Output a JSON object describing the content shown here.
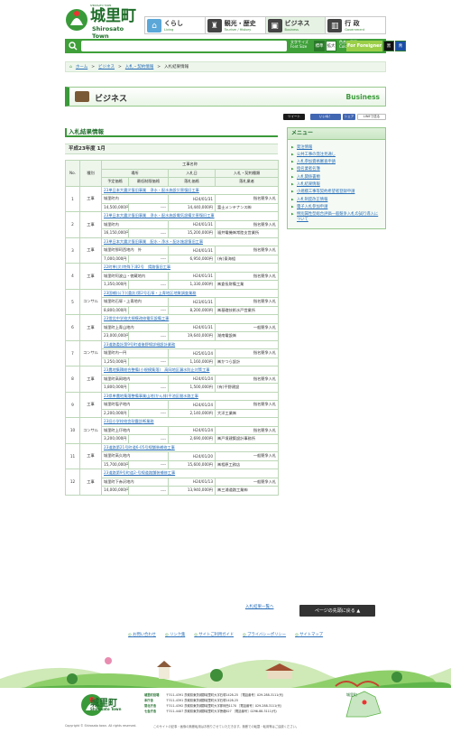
{
  "header": {
    "logo_tagline": "SHIROSATO TOWN",
    "logo_name": "城里町",
    "logo_en": "Shirosato Town",
    "nav": [
      {
        "label": "くらし",
        "en": "Living",
        "icon": "house-icon",
        "color": "#5aa7d8"
      },
      {
        "label": "観光・歴史",
        "en": "Tourism / History",
        "icon": "castle-icon",
        "color": "#444444"
      },
      {
        "label": "ビジネス",
        "en": "Business",
        "icon": "briefcase-icon",
        "color": "#444444"
      },
      {
        "label": "行 政",
        "en": "Government",
        "icon": "building-icon",
        "color": "#444444"
      }
    ],
    "search_placeholder": "",
    "font_size_label": "文字サイズ",
    "font_size_sub": "Font Size",
    "std_label": "標準",
    "large_label": "拡大",
    "color_label": "色合い変更",
    "color_sub": "Color Changer",
    "color_options": [
      "白",
      "黒",
      "青"
    ],
    "english_label": "For Foreigner"
  },
  "breadcrumb": [
    "ホーム",
    "ビジネス",
    "入札・契約情報",
    "入札結果情報"
  ],
  "page_heading": {
    "title": "ビジネス",
    "en": "Business"
  },
  "social": {
    "tweet": "ツイート",
    "like": "いいね！",
    "share": "シェア",
    "line": "LINEで送る"
  },
  "main": {
    "title": "入札結果情報",
    "period": "平成23年度 1月",
    "table_headers": {
      "no": "No.",
      "kind": "種別",
      "project": "工事名称",
      "location": "場所",
      "bid_date": "入札日",
      "method": "入札・契約種類",
      "planned_price": "予定価格",
      "min_price": "最低制限価格",
      "award_price": "落札価格",
      "awardee": "落札業者"
    },
    "rows": [
      {
        "no": "1",
        "kind": "工事",
        "name": "23単日本大震災復旧事業　浄水・配水施設災害復旧工事",
        "place": "城里町内",
        "date": "H24/01/31",
        "method": "指名競争入札",
        "planned": "14,500,000円",
        "min": "----",
        "award": "14,440,000円",
        "awardee": "富士メンテナンス㈱"
      },
      {
        "no": "2",
        "kind": "工事",
        "name": "23単日本大震災復旧事業　浄水・配水施設電気設備災害復旧工事",
        "place": "城里町内",
        "date": "H24/01/31",
        "method": "指名競争入札",
        "planned": "16,150,000円",
        "min": "----",
        "award": "15,200,000円",
        "awardee": "福井電機㈱常陸支営業所"
      },
      {
        "no": "3",
        "kind": "工事",
        "name": "23単日本大震災復旧事業　配水・浄水・配水施設復旧工事",
        "place": "城里町那珂西地内　外",
        "date": "H24/01/31",
        "method": "指名競争入札",
        "planned": "7,000,000円",
        "min": "----",
        "award": "6,950,000円",
        "awardee": "(有)東海組"
      },
      {
        "no": "4",
        "kind": "工事",
        "name": "22町単(災)特殊下津2号　錆路復旧工事",
        "place": "城里町阿波山・徳蔵地内",
        "date": "H24/01/31",
        "method": "指名競争入札",
        "planned": "1,350,000円",
        "min": "----",
        "award": "1,330,000円",
        "awardee": "㈱倉長財備工業"
      },
      {
        "no": "5",
        "kind": "コンサル",
        "name": "23国補(公下)(委託)第2号石塚・上青地区地質調査業務",
        "place": "城里町石塚・上青地内",
        "date": "H23/01/31",
        "method": "指名競争入札",
        "planned": "8,800,000円",
        "min": "----",
        "award": "8,200,000円",
        "awardee": "㈱基礎技術水戸営業所"
      },
      {
        "no": "6",
        "kind": "工事",
        "name": "23常北中学校大規模改修電気設備工事",
        "place": "城里町上青山地内",
        "date": "H24/01/31",
        "method": "一般競争入札",
        "planned": "23,000,000円",
        "min": "----",
        "award": "19,640,000円",
        "awardee": "湖南電設㈱"
      },
      {
        "no": "7",
        "kind": "コンサル",
        "name": "23道路委託第9号町道後野線詳細設計業務",
        "place": "城里町内一円",
        "date": "H25/01/24",
        "method": "指名競争入札",
        "planned": "1,250,000円",
        "min": "----",
        "award": "1,160,000円",
        "awardee": "㈱かつら設計"
      },
      {
        "no": "8",
        "kind": "工事",
        "name": "23農地集積総合整備(小規模集落)　高岡地区漏水防止対策工事",
        "place": "城里町高岡地内",
        "date": "H24/01/24",
        "method": "指名競争入札",
        "planned": "1,800,000円",
        "min": "----",
        "award": "1,500,000円",
        "awardee": "(有)平野建設"
      },
      {
        "no": "9",
        "kind": "工事",
        "name": "23県単農地集落整備事業山地(かん排)平池区間水路工事",
        "place": "城里町塩子地内",
        "date": "H24/01/24",
        "method": "指名競争入札",
        "planned": "2,200,000円",
        "min": "----",
        "award": "2,140,000円",
        "awardee": "大洋工業㈱"
      },
      {
        "no": "10",
        "kind": "コンサル",
        "name": "23旧小学校校舎耐震診断業務",
        "place": "城里町上圷地内",
        "date": "H24/01/24",
        "method": "指名競争入札",
        "planned": "3,200,000円",
        "min": "----",
        "award": "2,690,000円",
        "awardee": "㈱戸境建築設計事務所"
      },
      {
        "no": "11",
        "kind": "工事",
        "name": "23道路第21号町道6-05号線舗装補修工事",
        "place": "城里町高久地内",
        "date": "H24/01/20",
        "method": "一般競争入札",
        "planned": "15,700,000円",
        "min": "----",
        "award": "15,600,000円",
        "awardee": "㈱相原工務店"
      },
      {
        "no": "12",
        "kind": "工事",
        "name": "23道路第9号町道2-号線道路舗装補修工事",
        "place": "城里町下赤沢地内",
        "date": "H24/01/13",
        "method": "一般競争入札",
        "planned": "14,000,000円",
        "min": "----",
        "award": "13,940,000円",
        "awardee": "㈱三浦道路工業㈱"
      }
    ],
    "back_link": "入札結果一覧へ",
    "top_button": "ページの先頭に戻る ▲"
  },
  "sidebar": {
    "title": "メニュー",
    "items": [
      "発注情報",
      "公共工事の発注見通し",
      "入札参加資格審査申請",
      "指名業者名簿",
      "入札関係書類",
      "入札結果情報",
      "小規模工事等契約希望者登録申請",
      "入札制度改正情報",
      "電子入札参加申請",
      "特別属性型総合評価一般競争入札の試行導入について"
    ]
  },
  "footer": {
    "links": [
      "お問い合わせ",
      "リンク集",
      "サイトご利用ガイド",
      "プライバシーポリシー",
      "サイトマップ"
    ],
    "name": "城里町",
    "en": "Shirosato Town",
    "address_rows": [
      {
        "label": "城里町役場",
        "text": "〒311-4391 茨城県東茨城郡城里町大字石塚1428-25 ［電話番号］029-288-3111(代)"
      },
      {
        "label": "本庁舎",
        "text": "〒311-4391 茨城県東茨城郡城里町大字石塚1428-25"
      },
      {
        "label": "常北庁舎",
        "text": "〒311-4392 茨城県東茨城郡城里町大字那珂西1170 ［電話番号］029-288-3111(代)"
      },
      {
        "label": "七会庁舎",
        "text": "〒311-4407 茨城県東茨城郡城里町大字徳蔵627 ［電話番号］0296-88-3111(代)"
      }
    ],
    "map_label": "城里町",
    "copyright": "Copyright © Shirosato town. All rights reserved.",
    "note": "このサイトの記事・画像の無断転用はお断りさせていただきます。無断での転載・転用等はご遠慮ください。"
  }
}
